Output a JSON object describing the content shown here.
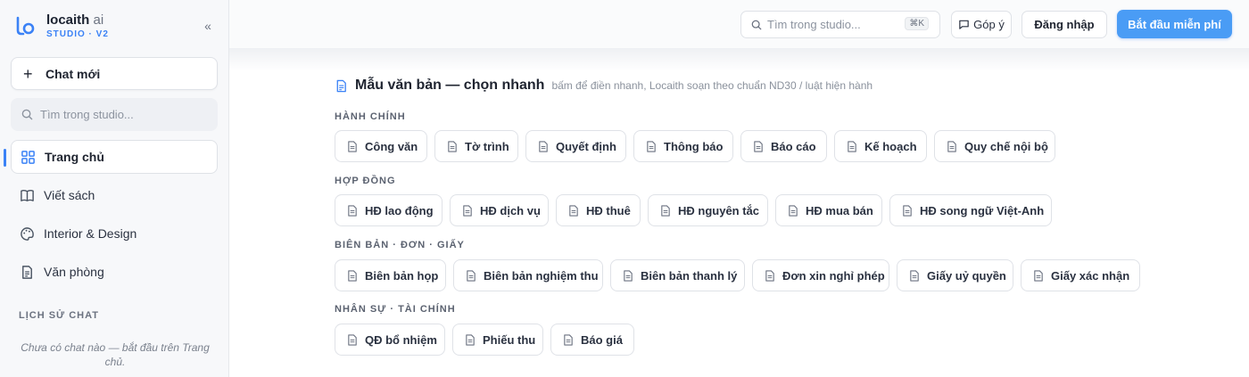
{
  "brand": {
    "name": "locaith",
    "name_suffix": "ai",
    "subtitle": "STUDIO · V2",
    "accent": "#3b82f6"
  },
  "sidebar": {
    "new_chat_label": "Chat mới",
    "search_placeholder": "Tìm trong studio...",
    "items": [
      {
        "label": "Trang chủ",
        "icon": "grid-icon",
        "active": true
      },
      {
        "label": "Viết sách",
        "icon": "book-icon",
        "active": false
      },
      {
        "label": "Interior & Design",
        "icon": "palette-icon",
        "active": false
      },
      {
        "label": "Văn phòng",
        "icon": "document-icon",
        "active": false
      }
    ],
    "history_title": "LỊCH SỬ CHAT",
    "history_empty": "Chưa có chat nào — bắt đầu trên Trang chủ."
  },
  "topbar": {
    "search_placeholder": "Tìm trong studio...",
    "search_shortcut": "⌘K",
    "feedback_label": "Góp ý",
    "login_label": "Đăng nhập",
    "start_label": "Bắt đầu miễn phí",
    "start_color": "#4a9cf5"
  },
  "templates": {
    "title": "Mẫu văn bản — chọn nhanh",
    "description": "bấm để điền nhanh, Locaith soạn theo chuẩn ND30 / luật hiện hành",
    "groups": [
      {
        "label": "HÀNH CHÍNH",
        "items": [
          "Công văn",
          "Tờ trình",
          "Quyết định",
          "Thông báo",
          "Báo cáo",
          "Kế hoạch",
          "Quy chế nội bộ"
        ]
      },
      {
        "label": "HỢP ĐỒNG",
        "items": [
          "HĐ lao động",
          "HĐ dịch vụ",
          "HĐ thuê",
          "HĐ nguyên tắc",
          "HĐ mua bán",
          "HĐ song ngữ Việt-Anh"
        ]
      },
      {
        "label": "BIÊN BẢN · ĐƠN · GIẤY",
        "items": [
          "Biên bản họp",
          "Biên bản nghiệm thu",
          "Biên bản thanh lý",
          "Đơn xin nghỉ phép",
          "Giấy uỷ quyền",
          "Giấy xác nhận"
        ]
      },
      {
        "label": "NHÂN SỰ · TÀI CHÍNH",
        "items": [
          "QĐ bổ nhiệm",
          "Phiếu thu",
          "Báo giá"
        ]
      }
    ]
  }
}
